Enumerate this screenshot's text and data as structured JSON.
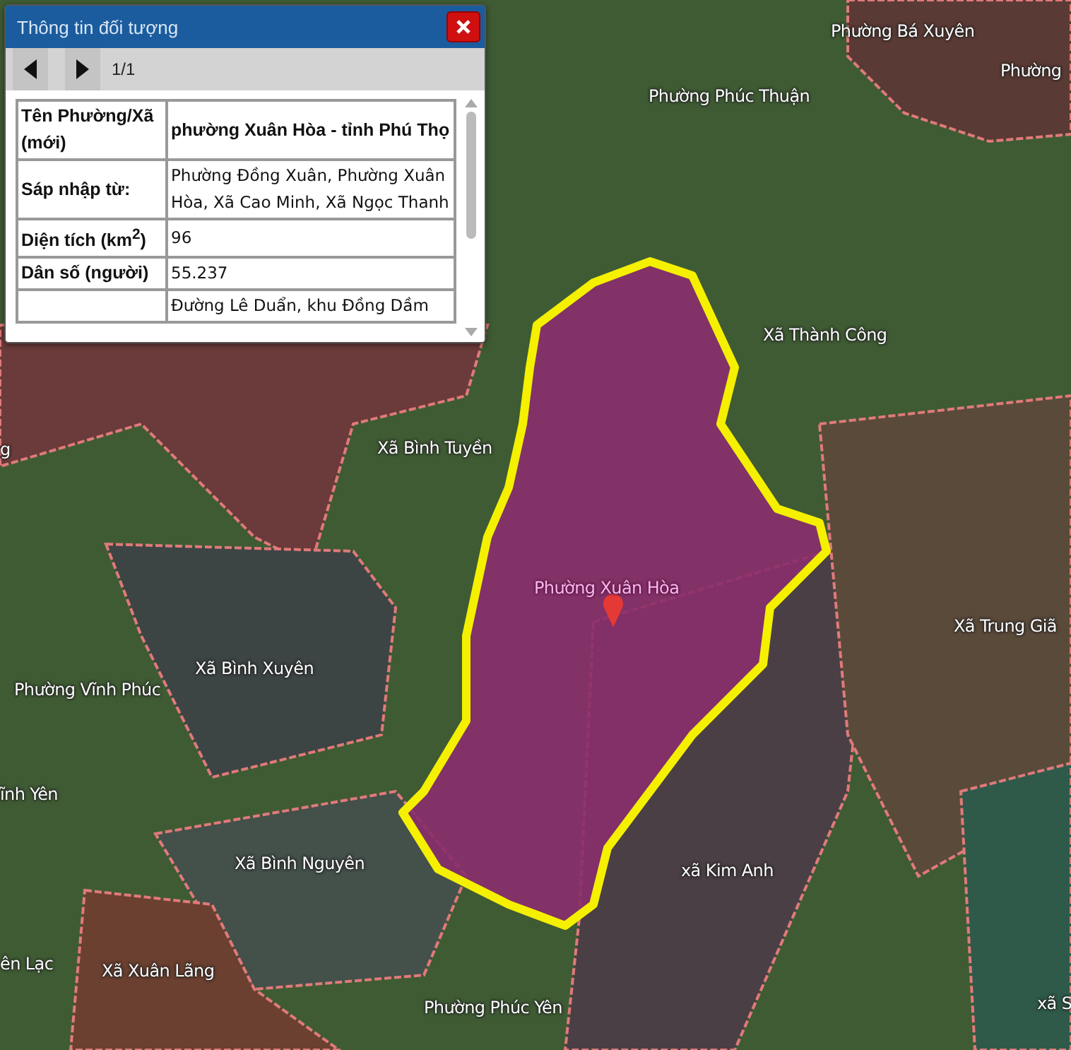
{
  "popup": {
    "title": "Thông tin đối tượng",
    "pager": "1/1",
    "rows": [
      {
        "label": "Tên Phường/Xã (mới)",
        "value": "phường Xuân Hòa - tỉnh Phú Thọ",
        "emphasis": true
      },
      {
        "label": "Sáp nhập từ:",
        "value": "Phường Đồng Xuân, Phường Xuân Hòa, Xã Cao Minh, Xã Ngọc Thanh",
        "emphasis": false
      },
      {
        "label": "Diện tích (km$^{2}$)",
        "value": "96",
        "emphasis": false
      },
      {
        "label": "Dân số (người)",
        "value": "55.237",
        "emphasis": false
      },
      {
        "value": "Đường Lê Duẩn, khu Đồng Dầm",
        "emphasis": false
      }
    ]
  },
  "map": {
    "labels": [
      {
        "text": "Phường Bá Xuyên",
        "kind": "place"
      },
      {
        "text": "Phường",
        "kind": "place"
      },
      {
        "text": "Phường Phúc Thuận",
        "kind": "place"
      },
      {
        "text": "Xã Thành Công",
        "kind": "place"
      },
      {
        "text": "g",
        "kind": "place"
      },
      {
        "text": "Xã Bình Tuyền",
        "kind": "place"
      },
      {
        "text": "Phường Xuân Hòa",
        "kind": "selected"
      },
      {
        "text": "Xã Trung Giã",
        "kind": "place"
      },
      {
        "text": "Xã Bình Xuyên",
        "kind": "place"
      },
      {
        "text": "Phường Vĩnh Phúc",
        "kind": "place"
      },
      {
        "text": "ĩnh Yên",
        "kind": "place"
      },
      {
        "text": "Xã Bình Nguyên",
        "kind": "place"
      },
      {
        "text": "xã Kim Anh",
        "kind": "place"
      },
      {
        "text": "ên Lạc",
        "kind": "place"
      },
      {
        "text": "Xã Xuân Lãng",
        "kind": "place"
      },
      {
        "text": "Phường Phúc Yên",
        "kind": "place"
      },
      {
        "text": "xã S",
        "kind": "place"
      }
    ]
  }
}
